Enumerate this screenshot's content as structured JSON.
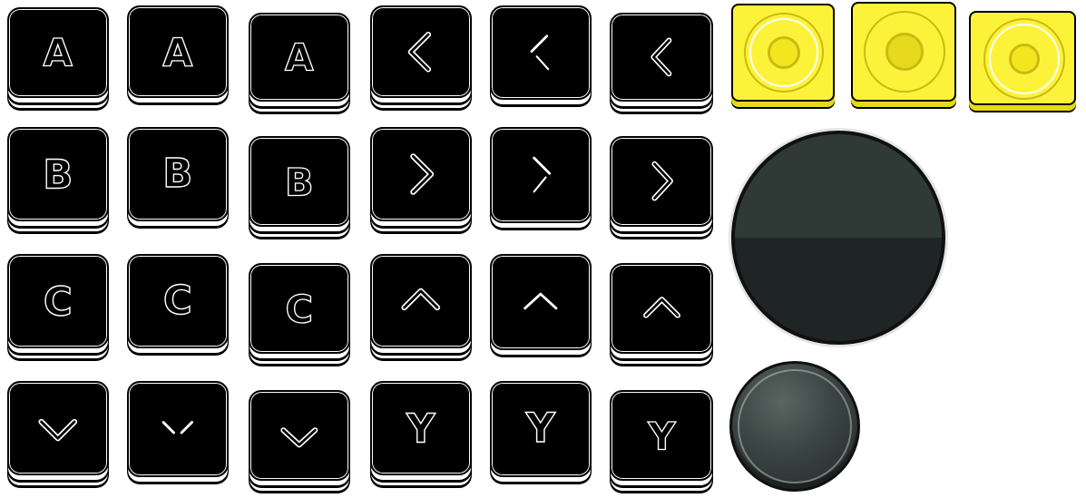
{
  "sprite_sheet": {
    "keys": [
      {
        "row": 1,
        "label": "A",
        "states": 3
      },
      {
        "row": 1,
        "icon": "chevron-left-icon",
        "states": 3
      },
      {
        "row": 2,
        "label": "B",
        "states": 3
      },
      {
        "row": 2,
        "icon": "chevron-right-icon",
        "states": 3
      },
      {
        "row": 3,
        "label": "C",
        "states": 3
      },
      {
        "row": 3,
        "icon": "chevron-up-icon",
        "states": 3
      },
      {
        "row": 4,
        "icon": "chevron-down-icon",
        "states": 3
      },
      {
        "row": 4,
        "label": "Y",
        "states": 3
      }
    ],
    "labels": {
      "a": "A",
      "b": "B",
      "c": "C",
      "y": "Y"
    },
    "yellow_buttons": {
      "count": 3,
      "icon": "circle-target-icon"
    },
    "joystick": {
      "base_icon": "joystick-base-icon",
      "knob_icon": "joystick-knob-icon"
    },
    "colors": {
      "key_fill": "#000000",
      "key_outline": "#ffffff",
      "yellow": "#fdf23a",
      "yellow_shade": "#c8bb12",
      "joystick_top": "#2f3a36",
      "joystick_bottom": "#1f2424"
    }
  }
}
